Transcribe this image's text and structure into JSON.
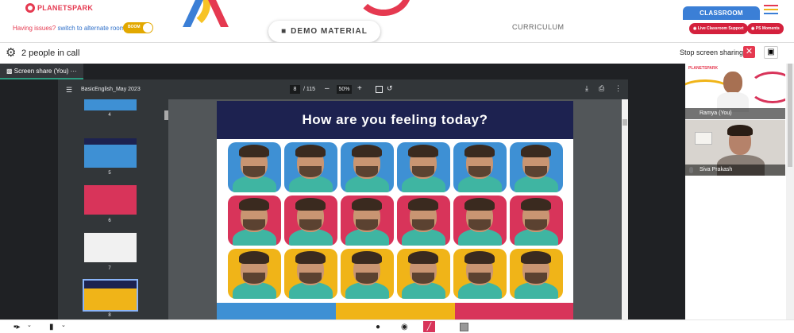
{
  "brand": {
    "name": "PLANETSPARK"
  },
  "header": {
    "issue_text": "Having issues?",
    "switch_text": "switch to alternate room",
    "toggle_label": "BOOM",
    "demo_label": "DEMO MATERIAL",
    "curriculum_label": "CURRICULUM",
    "classroom_label": "CLASSROOM",
    "live_support_label": "Live Classroom Support",
    "ps_moments_label": "PS Moments"
  },
  "call": {
    "people_text": "2 people in call",
    "stop_sharing_label": "Stop screen sharing"
  },
  "share": {
    "tab_label": "Screen share (You)",
    "tab_more": "···"
  },
  "viewer": {
    "file_name": "BasicEnglish_May 2023",
    "current_page": "8",
    "total_pages": "/ 115",
    "zoom": "50%",
    "thumbnails": [
      "4",
      "5",
      "6",
      "7",
      "8"
    ],
    "slide_title": "How are you feeling today?"
  },
  "participants": [
    {
      "name": "Ramya (You)"
    },
    {
      "name": "Siva Prakash"
    }
  ],
  "colors": {
    "brand_red": "#e53950",
    "brand_blue": "#3b7fd6",
    "tile_blue": "#3e90d4",
    "tile_red": "#d8345a",
    "tile_yellow": "#f0b418",
    "slide_header": "#1d2250"
  },
  "icons": {
    "gear": "gear-icon",
    "stop": "close-icon",
    "camera": "camera-icon",
    "mic": "microphone-icon",
    "person": "person-icon",
    "chat": "chat-icon",
    "screen_off": "screen-share-off-icon",
    "square": "stop-square-icon"
  }
}
